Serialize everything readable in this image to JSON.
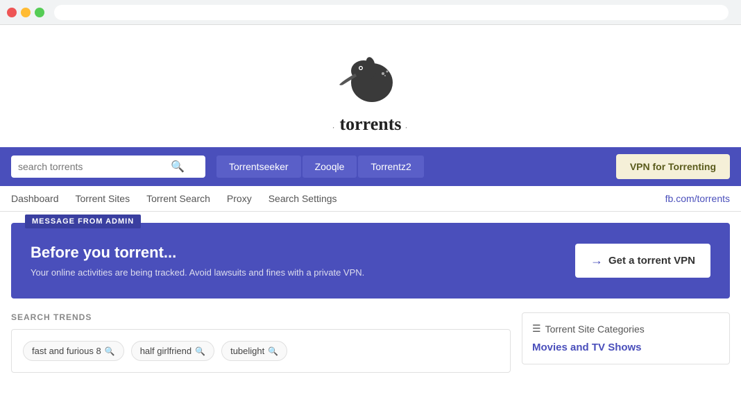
{
  "browser": {
    "tabs_placeholder": "browser chrome"
  },
  "logo": {
    "text": "torrents",
    "dots_text": "· torrents ·"
  },
  "search_bar": {
    "placeholder": "search torrents",
    "site_tabs": [
      "Torrentseeker",
      "Zooqle",
      "Torrentz2"
    ],
    "vpn_button_label": "VPN for Torrenting"
  },
  "nav": {
    "links": [
      "Dashboard",
      "Torrent Sites",
      "Torrent Search",
      "Proxy",
      "Search Settings"
    ],
    "fb_link": "fb.com/torrents"
  },
  "admin_banner": {
    "badge": "MESSAGE FROM ADMIN",
    "heading": "Before you torrent...",
    "body": "Your online activities are being tracked. Avoid lawsuits and fines with a private VPN.",
    "cta_label": "Get a torrent VPN",
    "cta_arrow": "→"
  },
  "trends": {
    "title": "SEARCH TRENDS",
    "items": [
      {
        "label": "fast and furious 8"
      },
      {
        "label": "half girlfriend"
      },
      {
        "label": "tubelight"
      }
    ]
  },
  "sidebar": {
    "categories_header": "Torrent Site Categories",
    "category_link": "Movies and TV Shows"
  }
}
